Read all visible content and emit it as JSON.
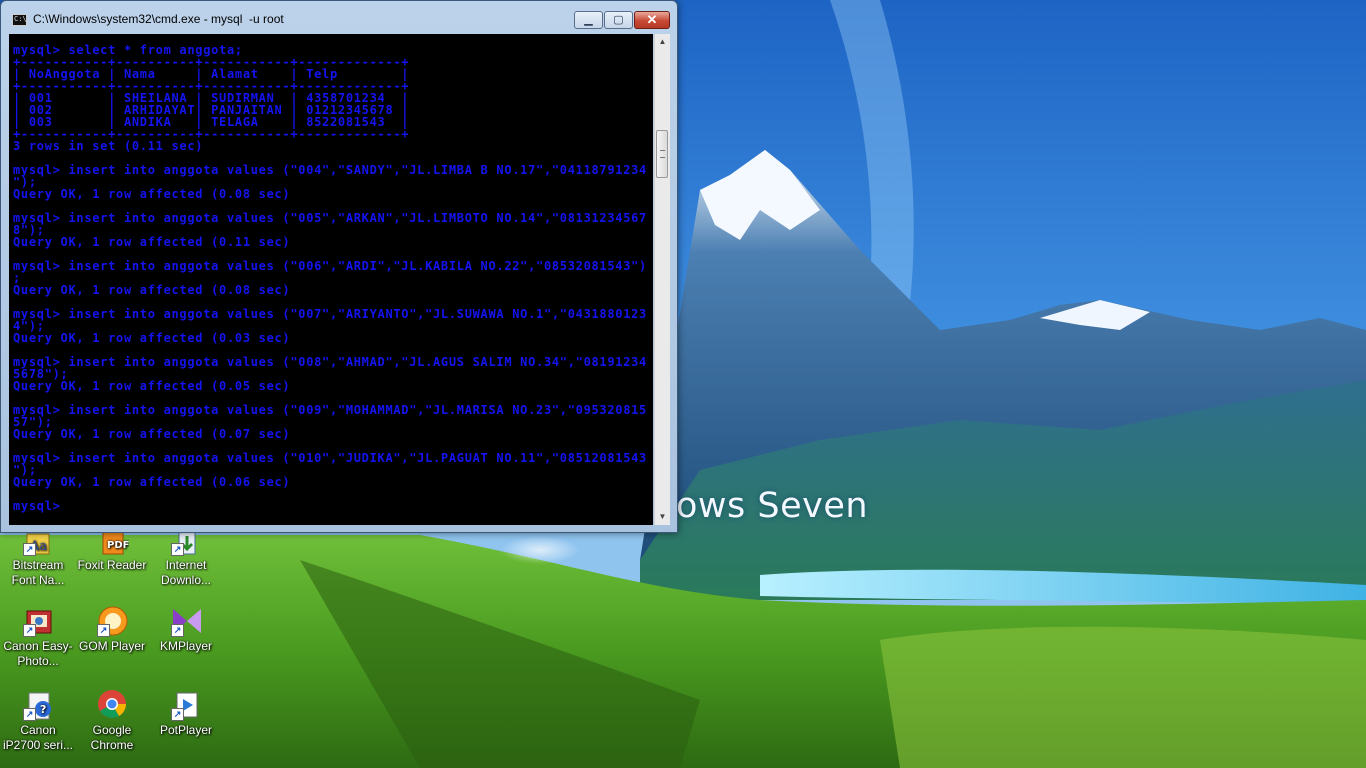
{
  "window": {
    "title": "C:\\Windows\\system32\\cmd.exe - mysql  -u root",
    "min_label": "▁",
    "max_label": "▢",
    "close_label": "✕",
    "console_color": "#1414f0"
  },
  "console_lines": [
    "mysql> select * from anggota;",
    "+-----------+----------+-----------+-------------+",
    "| NoAnggota | Nama     | Alamat    | Telp        |",
    "+-----------+----------+-----------+-------------+",
    "| 001       | SHEILANA | SUDIRMAN  | 4358701234  |",
    "| 002       | ARHIDAYAT| PANJAITAN | 01212345678 |",
    "| 003       | ANDIKA   | TELAGA    | 8522081543  |",
    "+-----------+----------+-----------+-------------+",
    "3 rows in set (0.11 sec)",
    "",
    "mysql> insert into anggota values (\"004\",\"SANDY\",\"JL.LIMBA B NO.17\",\"04118791234",
    "\");",
    "Query OK, 1 row affected (0.08 sec)",
    "",
    "mysql> insert into anggota values (\"005\",\"ARKAN\",\"JL.LIMBOTO NO.14\",\"08131234567",
    "8\");",
    "Query OK, 1 row affected (0.11 sec)",
    "",
    "mysql> insert into anggota values (\"006\",\"ARDI\",\"JL.KABILA NO.22\",\"08532081543\")",
    ";",
    "Query OK, 1 row affected (0.08 sec)",
    "",
    "mysql> insert into anggota values (\"007\",\"ARIYANTO\",\"JL.SUWAWA NO.1\",\"0431880123",
    "4\");",
    "Query OK, 1 row affected (0.03 sec)",
    "",
    "mysql> insert into anggota values (\"008\",\"AHMAD\",\"JL.AGUS SALIM NO.34\",\"08191234",
    "5678\");",
    "Query OK, 1 row affected (0.05 sec)",
    "",
    "mysql> insert into anggota values (\"009\",\"MOHAMMAD\",\"JL.MARISA NO.23\",\"095320815",
    "57\");",
    "Query OK, 1 row affected (0.07 sec)",
    "",
    "mysql> insert into anggota values (\"010\",\"JUDIKA\",\"JL.PAGUAT NO.11\",\"08512081543",
    "\");",
    "Query OK, 1 row affected (0.06 sec)",
    "",
    "mysql>"
  ],
  "wallpaper": {
    "brand_text": "ows Seven"
  },
  "desktop_icons": [
    {
      "label": "Bitstream Font Na...",
      "icon": "bitstream-font-navigator-icon"
    },
    {
      "label": "Foxit Reader",
      "icon": "foxit-reader-icon"
    },
    {
      "label": "Internet Downlo...",
      "icon": "internet-download-manager-icon"
    },
    {
      "label": "Canon Easy-Photo...",
      "icon": "canon-easy-photoprint-icon"
    },
    {
      "label": "GOM Player",
      "icon": "gom-player-icon"
    },
    {
      "label": "KMPlayer",
      "icon": "kmplayer-icon"
    },
    {
      "label": "Canon iP2700 seri...",
      "icon": "canon-printer-help-icon"
    },
    {
      "label": "Google Chrome",
      "icon": "google-chrome-icon"
    },
    {
      "label": "PotPlayer",
      "icon": "potplayer-icon"
    }
  ]
}
